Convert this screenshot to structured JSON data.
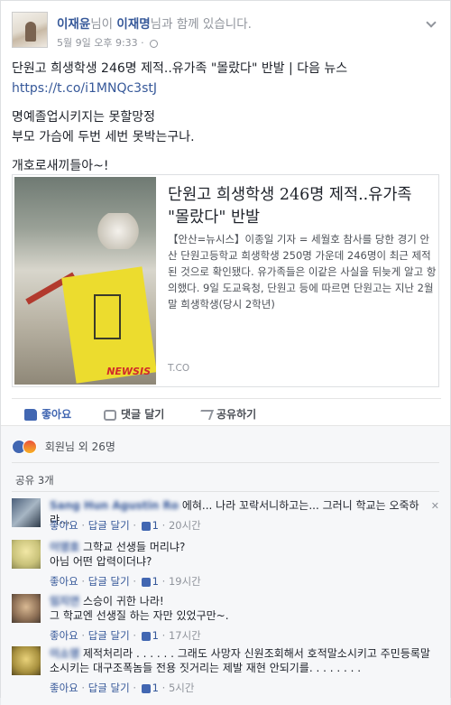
{
  "header": {
    "author": "이재윤",
    "connector_1": "님이 ",
    "tagged": "이재명",
    "connector_2": "님과 함께 있습니다.",
    "timestamp": "5월 9일 오후 9:33 · "
  },
  "post": {
    "line1": "단원고 희생학생 246명 제적..유가족 \"몰랐다\" 반발 | 다음 뉴스 ",
    "url": "https://t.co/i1MNQc3stJ",
    "line2": "명예졸업시키지는 못할망정",
    "line3": "부모 가슴에 두번 세번 못박는구나.",
    "line4": "개호로새끼들아~!"
  },
  "share": {
    "title": "단원고 희생학생 246명 제적..유가족 \"몰랐다\" 반발",
    "description": "【안산=뉴시스】이종일 기자 = 세월호 참사를 당한 경기 안산 단원고등학교 희생학생 250명 가운데 246명이 최근 제적된 것으로 확인됐다. 유가족들은 이같은 사실을 뒤늦게 알고 항의했다. 9일 도교육청, 단원고 등에 따르면 단원고는 지난 2월 말 희생학생(당시 2학년)",
    "source": "T.CO",
    "watermark": "NEWSIS"
  },
  "actions": {
    "like": "좋아요",
    "comment": "댓글 달기",
    "share": "공유하기"
  },
  "reactions": {
    "summary": "회원님 외 26명"
  },
  "share_count": "공유 3개",
  "comments": [
    {
      "name": "Sang Hun Agustin Ro",
      "text": "에혀... 나라 꼬락서니하고는... 그러니 학교는 오죽하랴...",
      "like": "좋아요",
      "reply": "답글 달기",
      "likes": "1",
      "time": "20시간"
    },
    {
      "name": "이영호",
      "text": "그학교 선생들 머리냐?\n아님 어떤 압력이더냐?",
      "like": "좋아요",
      "reply": "답글 달기",
      "likes": "1",
      "time": "19시간"
    },
    {
      "name": "임지연",
      "text": "스승이 귀한 나라!\n그 학교엔 선생질 하는 자만 있었구만~.",
      "like": "좋아요",
      "reply": "답글 달기",
      "likes": "1",
      "time": "17시간"
    },
    {
      "name": "이소영",
      "text": "제적처리라 . . . . . . 그래도 사망자 신원조회해서 호적말소시키고 주민등록말소시키는 대구조폭놈들 전용 짓거리는 제발 재현 안되기를. . . . . . . .",
      "like": "좋아요",
      "reply": "답글 달기",
      "likes": "1",
      "time": "5시간"
    }
  ]
}
